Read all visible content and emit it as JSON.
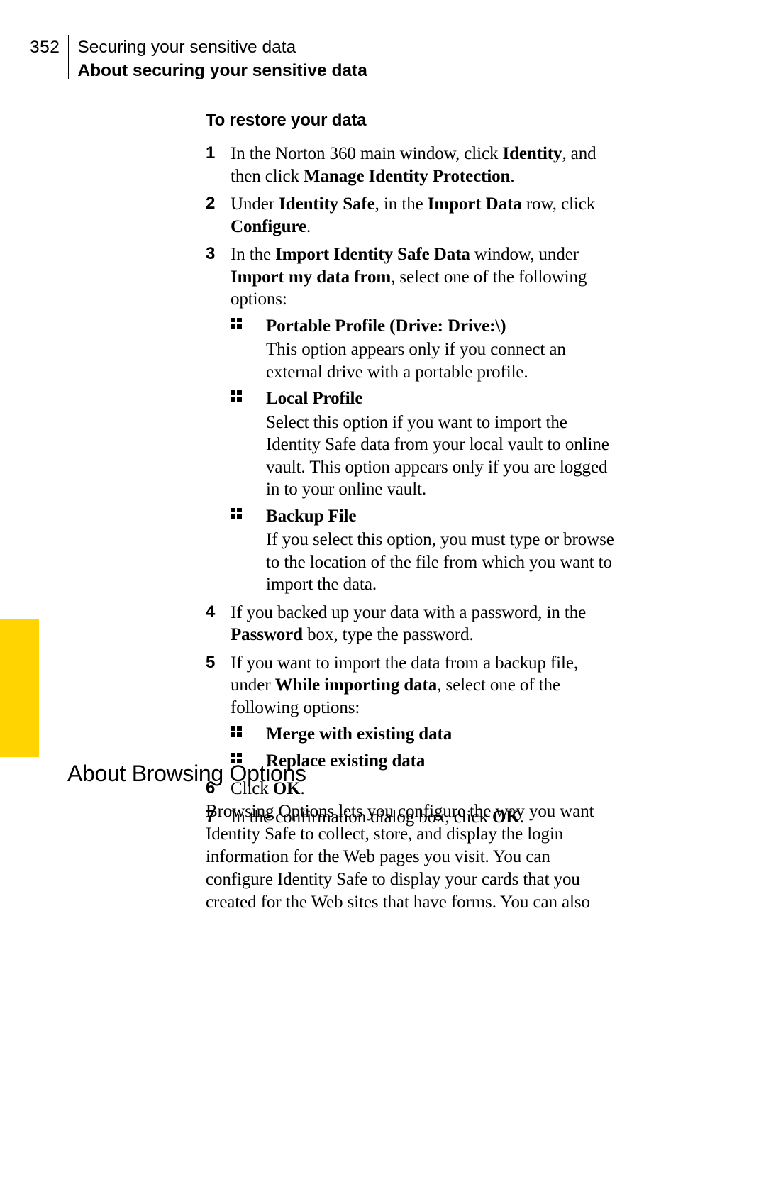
{
  "header": {
    "page_number": "352",
    "chapter": "Securing your sensitive data",
    "section": "About securing your sensitive data"
  },
  "restore": {
    "title": "To restore your data",
    "steps": {
      "s1a": "In the Norton 360 main window, click ",
      "s1b": "Identity",
      "s1c": ", and then click ",
      "s1d": "Manage Identity Protection",
      "s1e": ".",
      "s2a": "Under ",
      "s2b": "Identity Safe",
      "s2c": ", in the ",
      "s2d": "Import Data",
      "s2e": " row, click ",
      "s2f": "Configure",
      "s2g": ".",
      "s3a": "In the ",
      "s3b": "Import Identity Safe Data",
      "s3c": " window, under ",
      "s3d": "Import my data from",
      "s3e": ", select one of the following options:",
      "s3_opts": {
        "o1_title": "Portable Profile (Drive: Drive:\\)",
        "o1_desc": "This option appears only if you connect an external drive with a portable profile.",
        "o2_title": "Local Profile",
        "o2_desc": "Select this option if you want to import the Identity Safe data from your local vault to online vault. This option appears only if you are logged in to your online vault.",
        "o3_title": "Backup File",
        "o3_desc": "If you select this option, you must type or browse to the location of the file from which you want to import the data."
      },
      "s4a": "If you backed up your data with a password, in the ",
      "s4b": "Password",
      "s4c": " box, type the password.",
      "s5a": "If you want to import the data from a backup file, under ",
      "s5b": "While importing data",
      "s5c": ", select one of the following options:",
      "s5_opts": {
        "o1_title": "Merge with existing data",
        "o2_title": "Replace existing data"
      },
      "s6a": "Click ",
      "s6b": "OK",
      "s6c": ".",
      "s7a": "In the confirmation dialog box, click ",
      "s7b": "OK",
      "s7c": "."
    }
  },
  "browsing": {
    "heading": "About Browsing Options",
    "para": "Browsing Options lets you configure the way you want Identity Safe to collect, store, and display the login information for the Web pages you visit. You can configure Identity Safe to display your cards that you created for the Web sites that have forms. You can also"
  }
}
